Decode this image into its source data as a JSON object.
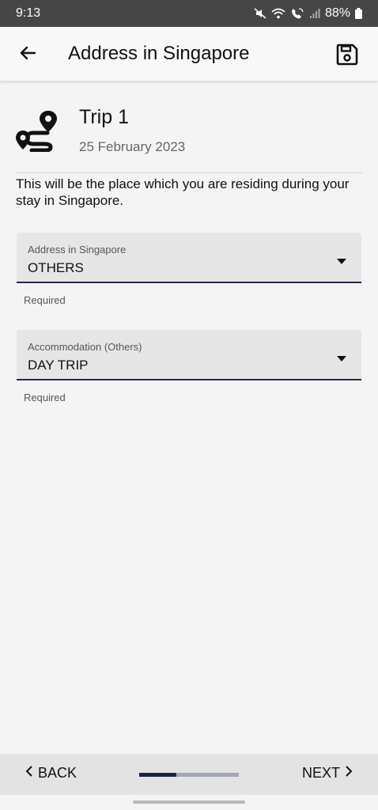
{
  "status_bar": {
    "time": "9:13",
    "battery": "88%",
    "icons": [
      "mute-icon",
      "wifi-icon",
      "wifi-calling-icon",
      "signal-icon",
      "battery-icon"
    ]
  },
  "app_bar": {
    "title": "Address in Singapore",
    "back_icon": "arrow-left-icon",
    "save_icon": "floppy-disk-icon"
  },
  "trip": {
    "icon": "route-icon",
    "name": "Trip 1",
    "date": "25 February 2023"
  },
  "description": "This will be the place which you are residing during your stay in Singapore.",
  "fields": [
    {
      "label": "Address in Singapore",
      "value": "OTHERS",
      "helper": "Required"
    },
    {
      "label": "Accommodation (Others)",
      "value": "DAY TRIP",
      "helper": "Required"
    }
  ],
  "bottom_nav": {
    "back_label": "BACK",
    "next_label": "NEXT",
    "progress": 0.37
  },
  "colors": {
    "accent": "#1c2145",
    "status_bar": "#464646",
    "background": "#f4f4f4"
  }
}
